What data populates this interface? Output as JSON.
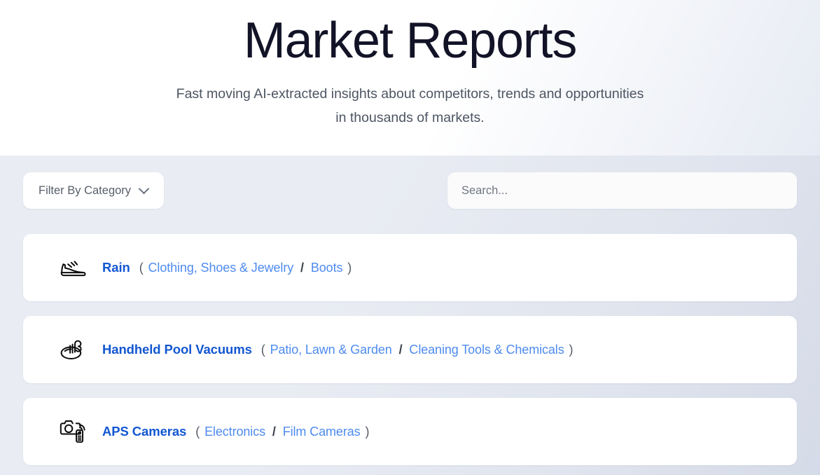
{
  "header": {
    "title": "Market Reports",
    "subtitle_line1": "Fast moving AI-extracted insights about competitors, trends and opportunities",
    "subtitle_line2": "in thousands of markets."
  },
  "controls": {
    "filter_label": "Filter By Category",
    "filter_icon": "chevron-down-icon",
    "search_placeholder": "Search...",
    "search_value": ""
  },
  "results": [
    {
      "icon": "sneaker-icon",
      "name": "Rain",
      "open_paren": "(",
      "category": "Clothing, Shoes & Jewelry",
      "separator": "/",
      "subcategory": "Boots",
      "close_paren": ")"
    },
    {
      "icon": "pool-vacuum-icon",
      "name": "Handheld Pool Vacuums",
      "open_paren": "(",
      "category": "Patio, Lawn & Garden",
      "separator": "/",
      "subcategory": "Cleaning Tools & Chemicals",
      "close_paren": ")"
    },
    {
      "icon": "camera-remote-icon",
      "name": "APS Cameras",
      "open_paren": "(",
      "category": "Electronics",
      "separator": "/",
      "subcategory": "Film Cameras",
      "close_paren": ")"
    }
  ],
  "colors": {
    "title": "#121327",
    "subtitle": "#4d5562",
    "report_name_blue": "#1357d1",
    "category_blue": "#4e8bef",
    "body_background": "#e9ecf3",
    "card_background": "#ffffff"
  }
}
